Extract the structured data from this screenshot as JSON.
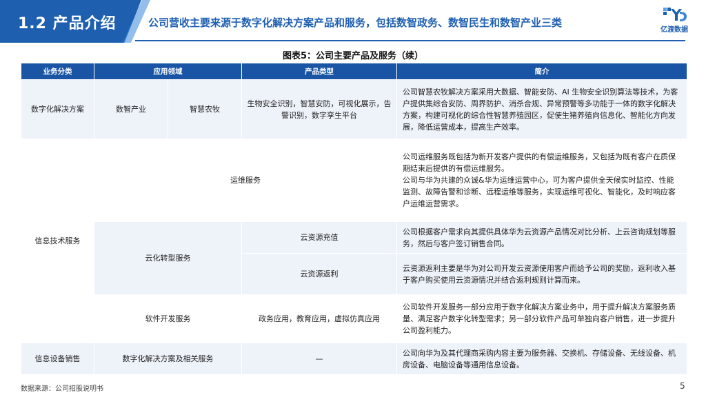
{
  "header": {
    "section_title": "1.2 产品介绍",
    "headline": "公司营收主要来源于数字化解决方案产品和服务，包括数智政务、数智民生和数智产业三类",
    "logo_text": "亿渡数据",
    "accent": "#1f5fb0"
  },
  "figure_title": "图表5：公司主要产品及服务（续）",
  "table": {
    "columns": [
      "业务分类",
      "应用领域",
      "产品类型",
      "简介"
    ],
    "rows": {
      "r1": {
        "category": "数字化解决方案",
        "area_1": "数智产业",
        "area_2": "智慧农牧",
        "type": "生物安全识别，智慧安防，可视化展示，告警识别，数字孪生平台",
        "desc": "公司智慧农牧解决方案采用大数据、智能安防、AI 生物安全识别算法等技术，为客户提供集综合安防、周界防护、消杀合规、异常预警等多功能于一体的数字化解决方案，构建可视化的综合性智慧养殖园区，促使生猪养殖向信息化、智能化方向发展，降低运营成本，提高生产效率。"
      },
      "r2": {
        "category": "信息技术服务",
        "area": "运维服务",
        "desc": "公司运维服务既包括为新开发客户提供的有偿运维服务，又包括为既有客户在质保期结束后提供的有偿运维服务。\n公司与华为共建的众诚&华为运维运营中心，可为客户提供全天候实时监控、性能监测、故障告警和诊断、远程运维等服务，实现运维可视化、智能化，及时响应客户运维运营需求。"
      },
      "r3": {
        "area": "云化转型服务",
        "type": "云资源充值",
        "desc": "公司根据客户需求向其提供具体华为云资源产品情况对比分析、上云咨询规划等服务，然后与客户签订销售合同。"
      },
      "r4": {
        "type": "云资源返利",
        "desc": "云资源返利主要是华为对公司开发云资源使用客户而给予公司的奖励，返利收入基于客户购买使用云资源情况并结合返利规则计算而来。"
      },
      "r5": {
        "area": "软件开发服务",
        "type": "政务应用，教育应用，虚拟仿真应用",
        "desc": "公司软件开发服务一部分应用于数字化解决方案业务中，用于提升解决方案服务质量、满足客户数字化转型需求；另一部分软件产品可单独向客户销售，进一步提升公司盈利能力。"
      },
      "r6": {
        "category": "信息设备销售",
        "area": "数字化解决方案及相关服务",
        "type": "—",
        "desc": "公司向华为及其代理商采购内容主要为服务器、交换机、存储设备、无线设备、机房设备、电脑设备等通用信息设备。"
      }
    }
  },
  "footer": {
    "source": "数据来源：公司招股说明书",
    "page": "5"
  }
}
